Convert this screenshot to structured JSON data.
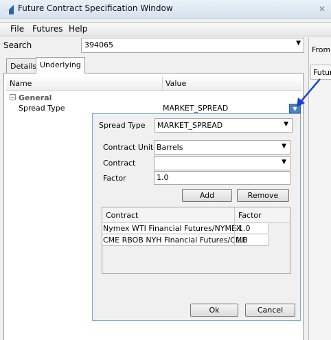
{
  "window": {
    "title": "Future Contract Specification Window",
    "close_glyph": "✕"
  },
  "menu": {
    "items": [
      "File",
      "Futures",
      "Help"
    ]
  },
  "search": {
    "label": "Search",
    "value": "394065"
  },
  "right_panel": {
    "from_label": "From I",
    "future_label": "Future"
  },
  "tabs": [
    "Details",
    "Underlying"
  ],
  "grid": {
    "headers": {
      "name": "Name",
      "value": "Value"
    },
    "group": "General",
    "rows": [
      {
        "name": "Spread Type",
        "value": "MARKET_SPREAD"
      }
    ]
  },
  "popup": {
    "spread_type": {
      "label": "Spread Type",
      "value": "MARKET_SPREAD"
    },
    "contract_unit": {
      "label": "Contract Unit",
      "value": "Barrels"
    },
    "contract": {
      "label": "Contract",
      "value": ""
    },
    "factor": {
      "label": "Factor",
      "value": "1.0"
    },
    "buttons": {
      "add": "Add",
      "remove": "Remove",
      "ok": "Ok",
      "cancel": "Cancel"
    },
    "table": {
      "headers": [
        "Contract",
        "Factor"
      ],
      "rows": [
        [
          "Nymex WTI Financial Futures/NYMEX",
          "-1.0"
        ],
        [
          "CME RBOB NYH Financial Futures/CME",
          "1.0"
        ]
      ]
    }
  },
  "icons": {
    "app": "window-app-icon",
    "close": "close-icon",
    "dropdown": "chevron-down-icon",
    "collapse": "collapse-icon",
    "pointer": "annotation-arrow-icon"
  },
  "colors": {
    "accent_blue": "#2f62a0",
    "arrow_blue": "#1a3fd6",
    "popup_border": "#7ea6d0"
  }
}
